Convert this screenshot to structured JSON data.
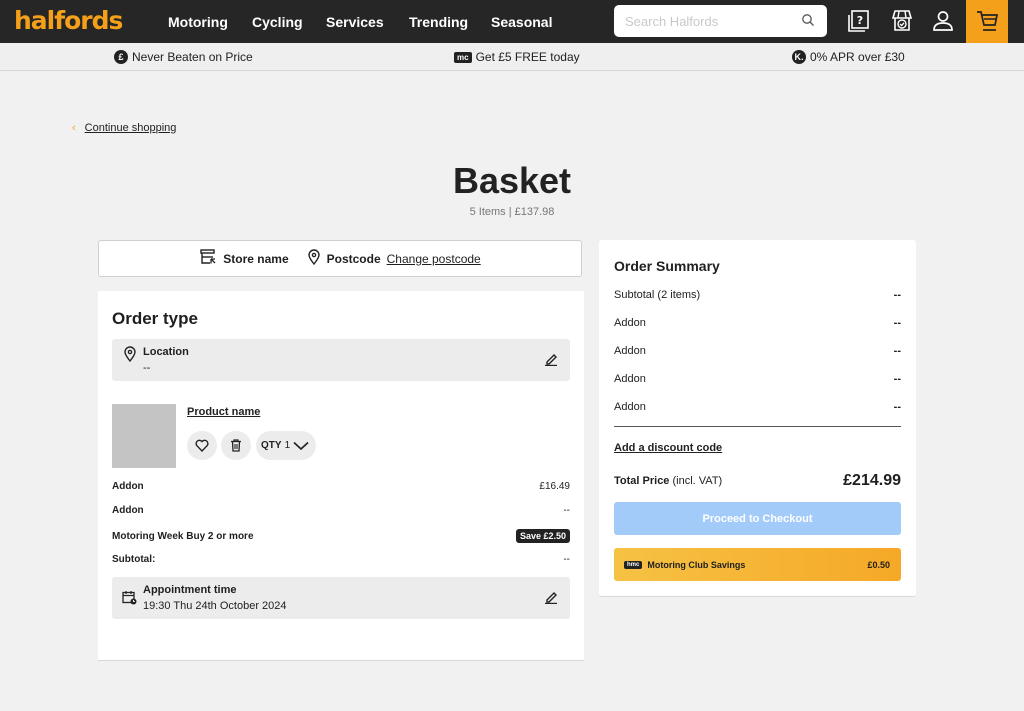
{
  "header": {
    "logo": "halfords",
    "nav": [
      "Motoring",
      "Cycling",
      "Services",
      "Trending",
      "Seasonal"
    ],
    "search_placeholder": "Search Halfords"
  },
  "promo": {
    "items": [
      {
        "badge": "£",
        "text": "Never Beaten on Price"
      },
      {
        "badge": "mc",
        "text": "Get £5 FREE today"
      },
      {
        "badge": "K.",
        "text": "0% APR over £30"
      }
    ]
  },
  "continue_label": "Continue shopping",
  "page": {
    "title": "Basket",
    "subtitle": "5 Items | £137.98"
  },
  "store_bar": {
    "store_label": "Store name",
    "postcode_label": "Postcode",
    "change_label": "Change postcode"
  },
  "order": {
    "title": "Order type",
    "location_label": "Location",
    "location_value": "--",
    "product_name": "Product name",
    "qty_label": "QTY",
    "qty_value": "1",
    "rows": [
      {
        "label": "Addon",
        "value": "£16.49"
      },
      {
        "label": "Addon",
        "value": "--"
      },
      {
        "label": "Motoring Week Buy 2 or more",
        "value": "Save £2.50"
      },
      {
        "label": "Subtotal:",
        "value": "--"
      }
    ],
    "appointment_label": "Appointment time",
    "appointment_value": "19:30 Thu 24th October 2024"
  },
  "summary": {
    "title": "Order Summary",
    "rows": [
      {
        "label": "Subtotal (2 items)",
        "value": "--"
      },
      {
        "label": "Addon",
        "value": "--"
      },
      {
        "label": "Addon",
        "value": "--"
      },
      {
        "label": "Addon",
        "value": "--"
      },
      {
        "label": "Addon",
        "value": "--"
      }
    ],
    "discount_label": "Add a discount code",
    "total_label": "Total Price",
    "total_note": "(incl. VAT)",
    "total_value": "£214.99",
    "checkout_label": "Proceed to Checkout",
    "club_badge": "hmc",
    "club_label": "Motoring Club Savings",
    "club_value": "£0.50"
  },
  "colors": {
    "brand": "#f5a01a",
    "dark": "#262626",
    "checkout_disabled": "#a3cbfa"
  }
}
